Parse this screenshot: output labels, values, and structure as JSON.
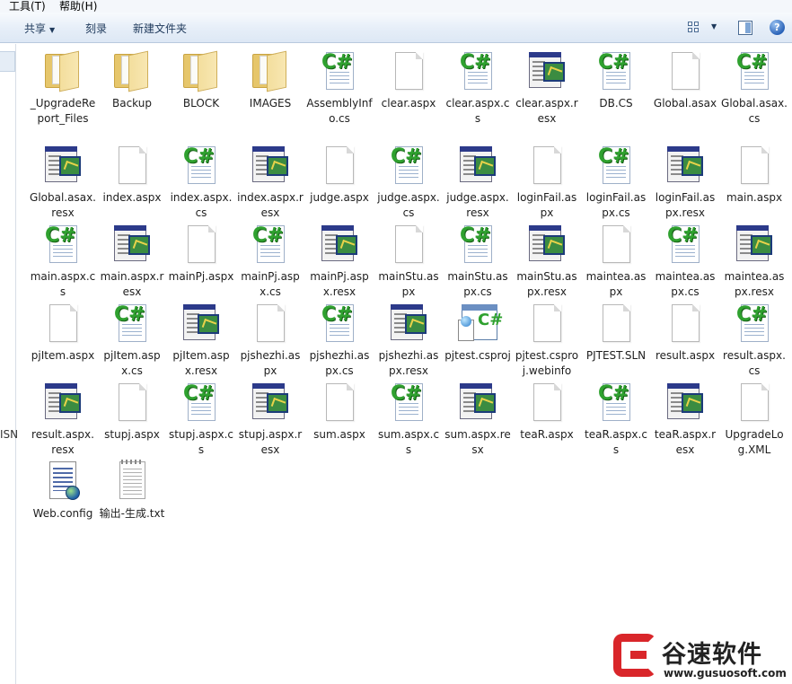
{
  "menu": {
    "tools": "工具(T)",
    "help": "帮助(H)"
  },
  "toolbar": {
    "share": "共享",
    "burn": "刻录",
    "new_folder": "新建文件夹",
    "help_glyph": "?"
  },
  "nav": {
    "clipped_label": "ISN"
  },
  "icon_types": {
    "folder": "folder-icon",
    "doc": "blank-document-icon",
    "cs": "csharp-file-icon",
    "resx": "resx-file-icon",
    "proj": "csproj-file-icon",
    "config": "config-file-icon",
    "txt": "text-file-icon"
  },
  "files": [
    {
      "name": "_UpgradeReport_Files",
      "type": "folder"
    },
    {
      "name": "Backup",
      "type": "folder"
    },
    {
      "name": "BLOCK",
      "type": "folder"
    },
    {
      "name": "IMAGES",
      "type": "folder"
    },
    {
      "name": "AssemblyInfo.cs",
      "type": "cs"
    },
    {
      "name": "clear.aspx",
      "type": "doc"
    },
    {
      "name": "clear.aspx.cs",
      "type": "cs"
    },
    {
      "name": "clear.aspx.resx",
      "type": "resx"
    },
    {
      "name": "DB.CS",
      "type": "cs"
    },
    {
      "name": "Global.asax",
      "type": "doc"
    },
    {
      "name": "Global.asax.cs",
      "type": "cs"
    },
    {
      "name": "Global.asax.resx",
      "type": "resx"
    },
    {
      "name": "index.aspx",
      "type": "doc"
    },
    {
      "name": "index.aspx.cs",
      "type": "cs"
    },
    {
      "name": "index.aspx.resx",
      "type": "resx"
    },
    {
      "name": "judge.aspx",
      "type": "doc"
    },
    {
      "name": "judge.aspx.cs",
      "type": "cs"
    },
    {
      "name": "judge.aspx.resx",
      "type": "resx"
    },
    {
      "name": "loginFail.aspx",
      "type": "doc"
    },
    {
      "name": "loginFail.aspx.cs",
      "type": "cs"
    },
    {
      "name": "loginFail.aspx.resx",
      "type": "resx"
    },
    {
      "name": "main.aspx",
      "type": "doc"
    },
    {
      "name": "main.aspx.cs",
      "type": "cs"
    },
    {
      "name": "main.aspx.resx",
      "type": "resx"
    },
    {
      "name": "mainPj.aspx",
      "type": "doc"
    },
    {
      "name": "mainPj.aspx.cs",
      "type": "cs"
    },
    {
      "name": "mainPj.aspx.resx",
      "type": "resx"
    },
    {
      "name": "mainStu.aspx",
      "type": "doc"
    },
    {
      "name": "mainStu.aspx.cs",
      "type": "cs"
    },
    {
      "name": "mainStu.aspx.resx",
      "type": "resx"
    },
    {
      "name": "maintea.aspx",
      "type": "doc"
    },
    {
      "name": "maintea.aspx.cs",
      "type": "cs"
    },
    {
      "name": "maintea.aspx.resx",
      "type": "resx"
    },
    {
      "name": "pjItem.aspx",
      "type": "doc"
    },
    {
      "name": "pjItem.aspx.cs",
      "type": "cs"
    },
    {
      "name": "pjItem.aspx.resx",
      "type": "resx"
    },
    {
      "name": "pjshezhi.aspx",
      "type": "doc"
    },
    {
      "name": "pjshezhi.aspx.cs",
      "type": "cs"
    },
    {
      "name": "pjshezhi.aspx.resx",
      "type": "resx"
    },
    {
      "name": "pjtest.csproj",
      "type": "proj"
    },
    {
      "name": "pjtest.csproj.webinfo",
      "type": "doc"
    },
    {
      "name": "PJTEST.SLN",
      "type": "doc"
    },
    {
      "name": "result.aspx",
      "type": "doc"
    },
    {
      "name": "result.aspx.cs",
      "type": "cs"
    },
    {
      "name": "result.aspx.resx",
      "type": "resx"
    },
    {
      "name": "stupj.aspx",
      "type": "doc"
    },
    {
      "name": "stupj.aspx.cs",
      "type": "cs"
    },
    {
      "name": "stupj.aspx.resx",
      "type": "resx"
    },
    {
      "name": "sum.aspx",
      "type": "doc"
    },
    {
      "name": "sum.aspx.cs",
      "type": "cs"
    },
    {
      "name": "sum.aspx.resx",
      "type": "resx"
    },
    {
      "name": "teaR.aspx",
      "type": "doc"
    },
    {
      "name": "teaR.aspx.cs",
      "type": "cs"
    },
    {
      "name": "teaR.aspx.resx",
      "type": "resx"
    },
    {
      "name": "UpgradeLog.XML",
      "type": "doc"
    },
    {
      "name": "Web.config",
      "type": "config"
    },
    {
      "name": "输出-生成.txt",
      "type": "txt"
    }
  ],
  "watermark": {
    "title": "谷速软件",
    "url": "www.gusuosoft.com"
  }
}
